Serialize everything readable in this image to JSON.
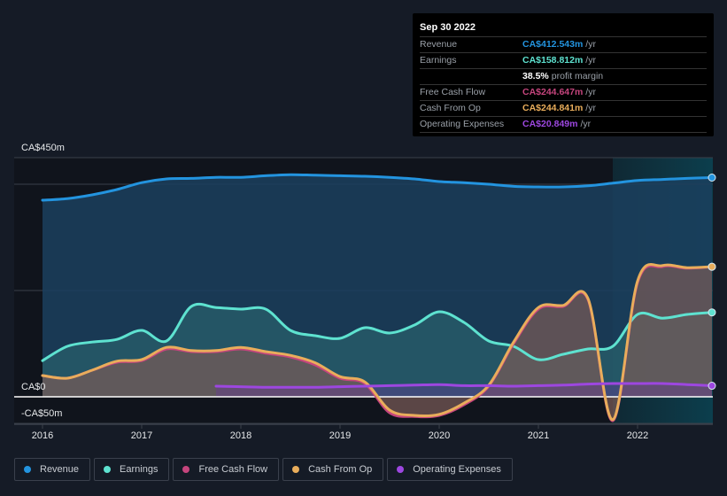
{
  "tooltip": {
    "date": "Sep 30 2022",
    "rows": [
      {
        "label": "Revenue",
        "value": "CA$412.543m",
        "unit": "/yr",
        "color": "#2394df"
      },
      {
        "label": "Earnings",
        "value": "CA$158.812m",
        "unit": "/yr",
        "color": "#5ee2d0"
      },
      {
        "label": "",
        "value": "38.5%",
        "unit": "profit margin",
        "color": "#ffffff"
      },
      {
        "label": "Free Cash Flow",
        "value": "CA$244.647m",
        "unit": "/yr",
        "color": "#c5457d"
      },
      {
        "label": "Cash From Op",
        "value": "CA$244.841m",
        "unit": "/yr",
        "color": "#e9ad5b"
      },
      {
        "label": "Operating Expenses",
        "value": "CA$20.849m",
        "unit": "/yr",
        "color": "#9d47e0"
      }
    ]
  },
  "legend": [
    {
      "label": "Revenue",
      "color": "#2394df"
    },
    {
      "label": "Earnings",
      "color": "#5ee2d0"
    },
    {
      "label": "Free Cash Flow",
      "color": "#c5457d"
    },
    {
      "label": "Cash From Op",
      "color": "#e9ad5b"
    },
    {
      "label": "Operating Expenses",
      "color": "#9d47e0"
    }
  ],
  "chart_data": {
    "type": "area",
    "title": "",
    "xlabel": "",
    "ylabel": "",
    "unit": "CA$ millions",
    "ylim": [
      -50,
      450
    ],
    "xlim": [
      2015.9,
      2022.8
    ],
    "y_tick_labels": [
      "CA$450m",
      "CA$0",
      "-CA$50m"
    ],
    "y_gridlines": [
      450,
      400,
      200,
      0,
      -50
    ],
    "x_tick_labels": [
      "2016",
      "2017",
      "2018",
      "2019",
      "2020",
      "2021",
      "2022"
    ],
    "x_ticks": [
      2016,
      2017,
      2018,
      2019,
      2020,
      2021,
      2022
    ],
    "highlight_start": 2021.75,
    "series": [
      {
        "name": "Revenue",
        "color": "#2394df",
        "x": [
          2016.0,
          2016.25,
          2016.5,
          2016.75,
          2017.0,
          2017.25,
          2017.5,
          2017.75,
          2018.0,
          2018.25,
          2018.5,
          2018.75,
          2019.0,
          2019.25,
          2019.5,
          2019.75,
          2020.0,
          2020.25,
          2020.5,
          2020.75,
          2021.0,
          2021.25,
          2021.5,
          2021.75,
          2022.0,
          2022.25,
          2022.5,
          2022.75
        ],
        "values": [
          370,
          373,
          380,
          390,
          403,
          410,
          411,
          413,
          413,
          416,
          418,
          417,
          416,
          415,
          413,
          410,
          405,
          403,
          400,
          396,
          395,
          395,
          397,
          402,
          407,
          409,
          411,
          412.5
        ]
      },
      {
        "name": "Earnings",
        "color": "#5ee2d0",
        "x": [
          2016.0,
          2016.25,
          2016.5,
          2016.75,
          2017.0,
          2017.25,
          2017.5,
          2017.75,
          2018.0,
          2018.25,
          2018.5,
          2018.75,
          2019.0,
          2019.25,
          2019.5,
          2019.75,
          2020.0,
          2020.25,
          2020.5,
          2020.75,
          2021.0,
          2021.25,
          2021.5,
          2021.75,
          2022.0,
          2022.25,
          2022.5,
          2022.75
        ],
        "values": [
          68,
          95,
          103,
          108,
          125,
          105,
          170,
          168,
          165,
          165,
          125,
          115,
          110,
          130,
          120,
          135,
          160,
          140,
          105,
          95,
          70,
          80,
          90,
          95,
          155,
          148,
          155,
          158.8
        ]
      },
      {
        "name": "Free Cash Flow",
        "color": "#c5457d",
        "x": [
          2016.0,
          2016.25,
          2016.5,
          2016.75,
          2017.0,
          2017.25,
          2017.5,
          2017.75,
          2018.0,
          2018.25,
          2018.5,
          2018.75,
          2019.0,
          2019.25,
          2019.5,
          2019.75,
          2020.0,
          2020.25,
          2020.5,
          2020.75,
          2021.0,
          2021.25,
          2021.5,
          2021.75,
          2022.0,
          2022.25,
          2022.5,
          2022.75
        ],
        "values": [
          40,
          35,
          50,
          65,
          68,
          90,
          85,
          85,
          90,
          82,
          75,
          60,
          35,
          25,
          -30,
          -37,
          -35,
          -15,
          20,
          100,
          165,
          170,
          183,
          -45,
          215,
          245,
          242,
          244.6
        ]
      },
      {
        "name": "Cash From Op",
        "color": "#e9ad5b",
        "x": [
          2016.0,
          2016.25,
          2016.5,
          2016.75,
          2017.0,
          2017.25,
          2017.5,
          2017.75,
          2018.0,
          2018.25,
          2018.5,
          2018.75,
          2019.0,
          2019.25,
          2019.5,
          2019.75,
          2020.0,
          2020.25,
          2020.5,
          2020.75,
          2021.0,
          2021.25,
          2021.5,
          2021.75,
          2022.0,
          2022.25,
          2022.5,
          2022.75
        ],
        "values": [
          40,
          35,
          50,
          67,
          70,
          93,
          87,
          87,
          93,
          85,
          78,
          64,
          38,
          28,
          -25,
          -35,
          -33,
          -12,
          22,
          103,
          168,
          172,
          185,
          -43,
          218,
          247,
          243,
          244.8
        ]
      },
      {
        "name": "Operating Expenses",
        "color": "#9d47e0",
        "x": [
          2017.75,
          2018.0,
          2018.25,
          2018.5,
          2018.75,
          2019.0,
          2019.25,
          2019.5,
          2019.75,
          2020.0,
          2020.25,
          2020.5,
          2020.75,
          2021.0,
          2021.25,
          2021.5,
          2021.75,
          2022.0,
          2022.25,
          2022.5,
          2022.75
        ],
        "values": [
          20,
          19,
          18,
          18,
          18,
          19,
          20,
          21,
          22,
          23,
          21,
          21,
          20,
          21,
          22,
          24,
          25,
          25,
          25,
          23,
          20.8
        ]
      }
    ]
  }
}
